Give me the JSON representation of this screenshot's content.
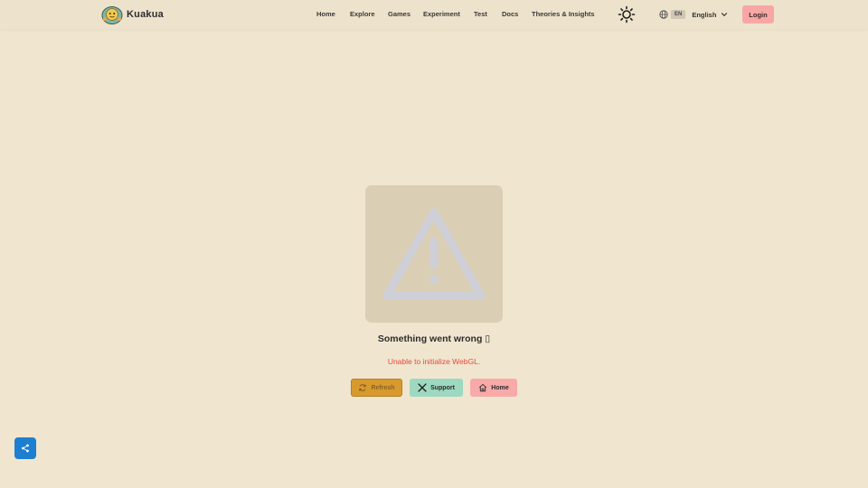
{
  "brand": {
    "name": "Kuakua"
  },
  "nav": {
    "items": [
      {
        "label": "Home"
      },
      {
        "label": "Explore"
      },
      {
        "label": "Games"
      },
      {
        "label": "Experiment"
      },
      {
        "label": "Test"
      },
      {
        "label": "Docs"
      },
      {
        "label": "Theories & Insights"
      }
    ]
  },
  "language": {
    "code": "EN",
    "name": "English"
  },
  "login": {
    "label": "Login"
  },
  "error": {
    "title": "Something went wrong ▯",
    "message": "Unable to initialize WebGL."
  },
  "actions": {
    "refresh": "Refresh",
    "support": "Support",
    "home": "Home"
  },
  "icons": {
    "theme": "sun-icon",
    "language": "globe-icon",
    "dropdown": "chevron-down-icon",
    "warning": "warning-triangle-icon",
    "refresh": "refresh-icon",
    "support": "x-logo-icon",
    "home": "home-icon",
    "share": "share-icon"
  },
  "colors": {
    "background": "#f0e5cf",
    "login_button": "#f8a7a5",
    "refresh_button": "#d89a2e",
    "support_button": "#9dd9c0",
    "home_button": "#f8aaa8",
    "error_text": "#e8493a",
    "share_button": "#1d7fd0"
  }
}
